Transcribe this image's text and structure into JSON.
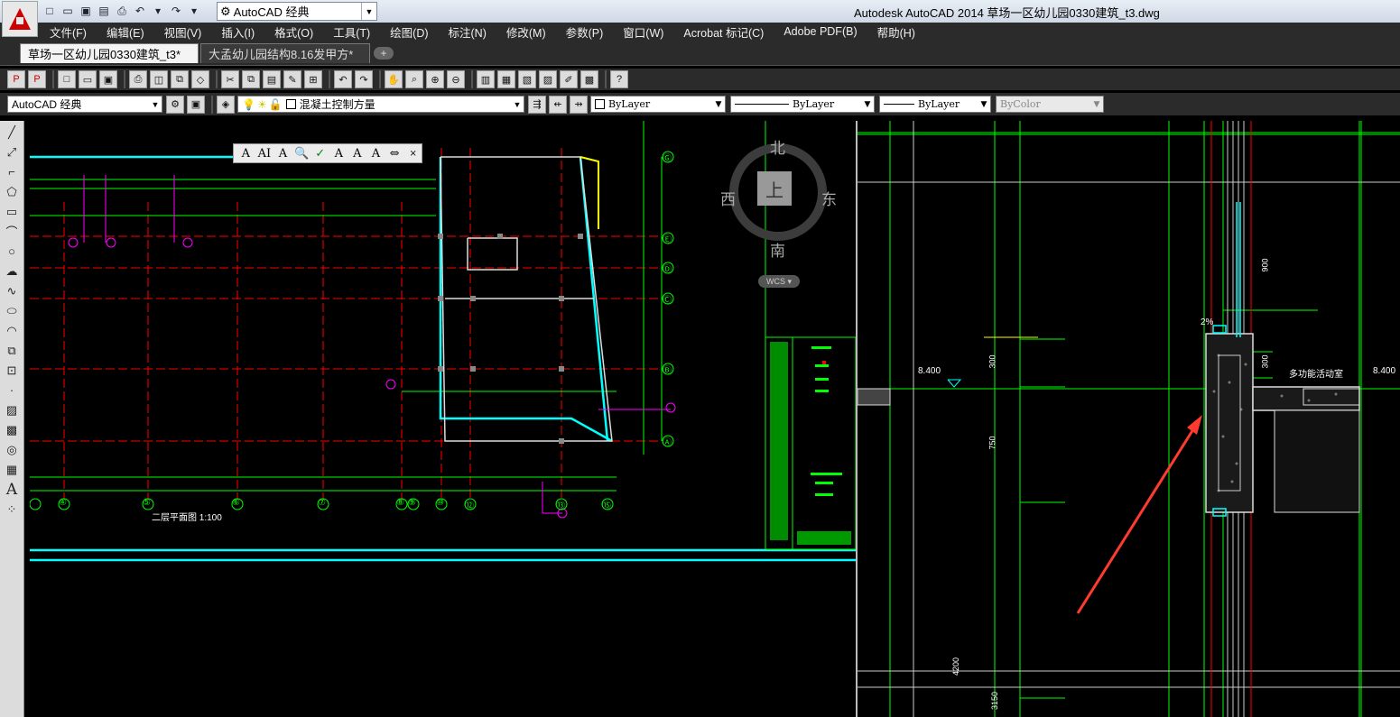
{
  "titlebar": {
    "title": "Autodesk AutoCAD 2014    草场一区幼儿园0330建筑_t3.dwg",
    "workspace": "AutoCAD 经典",
    "qat_icons": [
      "new-icon",
      "open-icon",
      "save-icon",
      "saveas-icon",
      "plot-icon",
      "undo-icon",
      "redo-icon"
    ]
  },
  "menu": {
    "items": [
      "文件(F)",
      "编辑(E)",
      "视图(V)",
      "插入(I)",
      "格式(O)",
      "工具(T)",
      "绘图(D)",
      "标注(N)",
      "修改(M)",
      "参数(P)",
      "窗口(W)",
      "Acrobat 标记(C)",
      "Adobe PDF(B)",
      "帮助(H)"
    ]
  },
  "tabs": [
    {
      "label": "草场一区幼儿园0330建筑_t3*",
      "active": true
    },
    {
      "label": "大孟幼儿园结构8.16发甲方*",
      "active": false
    }
  ],
  "toolbar2": {
    "workspace": "AutoCAD 经典",
    "layer": "混凝土控制方量",
    "color": "ByLayer",
    "linetype": "ByLayer",
    "lineweight": "ByLayer",
    "plotstyle": "ByColor"
  },
  "viewcube": {
    "north": "北",
    "south": "南",
    "west": "西",
    "east": "东",
    "face": "上",
    "ucs": "WCS"
  },
  "drawing_left": {
    "grid_x_labels": [
      "④",
      "⑤",
      "⑥",
      "⑦",
      "⑧",
      "⑨",
      "⑩",
      "⑫",
      "⑬",
      "⑮"
    ],
    "grid_y_labels": [
      "Ⓖ",
      "Ⓔ",
      "Ⓓ",
      "Ⓒ",
      "Ⓑ",
      "Ⓐ"
    ],
    "plan_title": "二层平面图 1:100"
  },
  "drawing_right": {
    "elev_left": "8.400",
    "elev_right": "8.400",
    "dim_labels": [
      "300",
      "750",
      "300",
      "900",
      "4200",
      "3150"
    ],
    "room_label": "多功能活动室",
    "slope": "2%"
  },
  "colors": {
    "accent_red": "#ff3b30",
    "cad_green": "#00ff00",
    "cad_cyan": "#00ffff",
    "cad_red": "#ff0000",
    "cad_magenta": "#ff00ff",
    "cad_yellow": "#ffff00"
  }
}
